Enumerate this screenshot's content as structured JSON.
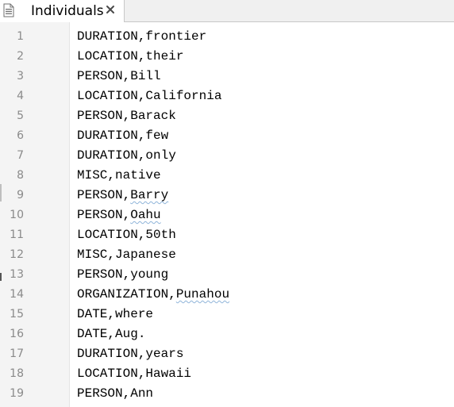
{
  "tab": {
    "title": "Individuals",
    "icon": "text-document-icon",
    "close_icon": "close-icon"
  },
  "colors": {
    "line_number": "#8a8a8a",
    "gutter_background": "#f4f4f4",
    "tab_bar": "#f0f0f0",
    "spellcheck_underline": "#8fb4d9"
  },
  "lines": [
    {
      "number": "1",
      "text": "DURATION,frontier"
    },
    {
      "number": "2",
      "text": "LOCATION,their"
    },
    {
      "number": "3",
      "text": "PERSON,Bill"
    },
    {
      "number": "4",
      "text": "LOCATION,California"
    },
    {
      "number": "5",
      "text": "PERSON,Barack"
    },
    {
      "number": "6",
      "text": "DURATION,few"
    },
    {
      "number": "7",
      "text": "DURATION,only"
    },
    {
      "number": "8",
      "text": "MISC,native"
    },
    {
      "number": "9",
      "text": "PERSON,Barry"
    },
    {
      "number": "10",
      "text": "PERSON,Oahu"
    },
    {
      "number": "11",
      "text": "LOCATION,50th"
    },
    {
      "number": "12",
      "text": "MISC,Japanese"
    },
    {
      "number": "13",
      "text": "PERSON,young"
    },
    {
      "number": "14",
      "text": "ORGANIZATION,Punahou"
    },
    {
      "number": "15",
      "text": "DATE,where"
    },
    {
      "number": "16",
      "text": "DATE,Aug."
    },
    {
      "number": "17",
      "text": "DURATION,years"
    },
    {
      "number": "18",
      "text": "LOCATION,Hawaii"
    },
    {
      "number": "19",
      "text": "PERSON,Ann"
    }
  ],
  "spellchecked_lines": [
    "9",
    "10",
    "14"
  ]
}
